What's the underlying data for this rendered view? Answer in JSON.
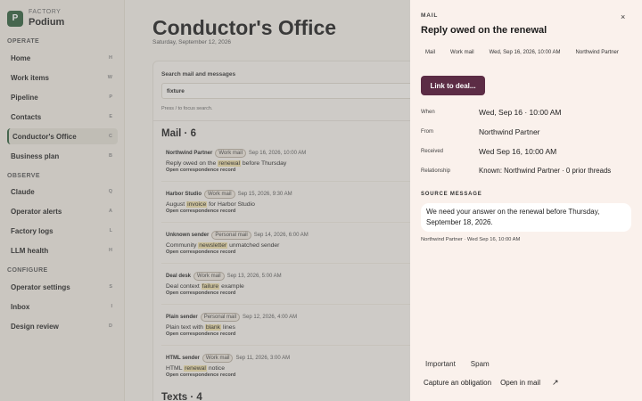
{
  "brand": {
    "kicker": "FACTORY",
    "name": "Podium",
    "logo": "P"
  },
  "sidebar": {
    "sections": [
      {
        "label": "OPERATE"
      },
      {
        "label": "OBSERVE"
      },
      {
        "label": "CONFIGURE"
      }
    ],
    "items": [
      {
        "label": "Home",
        "key": "H"
      },
      {
        "label": "Work items",
        "key": "W"
      },
      {
        "label": "Pipeline",
        "key": "P"
      },
      {
        "label": "Contacts",
        "key": "E"
      },
      {
        "label": "Conductor's Office",
        "key": "C"
      },
      {
        "label": "Business plan",
        "key": "B"
      },
      {
        "label": "Claude",
        "key": "Q"
      },
      {
        "label": "Operator alerts",
        "key": "A"
      },
      {
        "label": "Factory logs",
        "key": "L"
      },
      {
        "label": "LLM health",
        "key": "H"
      },
      {
        "label": "Operator settings",
        "key": "S"
      },
      {
        "label": "Inbox",
        "key": "I"
      },
      {
        "label": "Design review",
        "key": "D"
      }
    ]
  },
  "main": {
    "title": "Conductor's Office",
    "date": "Saturday, September 12, 2026",
    "search": {
      "label": "Search mail and messages",
      "value": "fixture",
      "hint": "Press / to focus search."
    },
    "mail_heading": "Mail · 6",
    "texts_heading": "Texts · 4",
    "mails": [
      {
        "sender": "Northwind Partner",
        "badge": "Work mail",
        "date": "Sep 16, 2026, 10:00 AM",
        "pre": "Reply owed on the ",
        "hl": "renewal",
        "post": " before Thursday",
        "link": "Open correspondence record"
      },
      {
        "sender": "Harbor Studio",
        "badge": "Work mail",
        "date": "Sep 15, 2026, 9:30 AM",
        "pre": "August ",
        "hl": "invoice",
        "post": " for Harbor Studio",
        "link": "Open correspondence record"
      },
      {
        "sender": "Unknown sender",
        "badge": "Personal mail",
        "date": "Sep 14, 2026, 6:00 AM",
        "pre": "Community ",
        "hl": "newsletter",
        "post": " unmatched sender",
        "link": "Open correspondence record"
      },
      {
        "sender": "Deal desk",
        "badge": "Work mail",
        "date": "Sep 13, 2026, 5:00 AM",
        "pre": "Deal context ",
        "hl": "failure",
        "post": " example",
        "link": "Open correspondence record"
      },
      {
        "sender": "Plain sender",
        "badge": "Personal mail",
        "date": "Sep 12, 2026, 4:00 AM",
        "pre": "Plain text with ",
        "hl": "blank",
        "post": " lines",
        "link": "Open correspondence record"
      },
      {
        "sender": "HTML sender",
        "badge": "Work mail",
        "date": "Sep 11, 2026, 3:00 AM",
        "pre": "HTML ",
        "hl": "renewal",
        "post": " notice",
        "link": "Open correspondence record"
      }
    ]
  },
  "drawer": {
    "kicker": "MAIL",
    "close": "×",
    "title": "Reply owed on the renewal",
    "tags": [
      "Mail",
      "Work mail",
      "Wed, Sep 16, 2026, 10:00 AM",
      "Northwind Partner"
    ],
    "link_button": "Link to deal...",
    "meta": [
      {
        "key": "When",
        "value": "Wed, Sep 16 · 10:00 AM"
      },
      {
        "key": "From",
        "value": "Northwind Partner"
      },
      {
        "key": "Received",
        "value": "Wed Sep 16, 10:00 AM"
      },
      {
        "key": "Relationship",
        "value": "Known: Northwind Partner · 0 prior threads"
      }
    ],
    "source_label": "SOURCE MESSAGE",
    "source_body": "We need your answer on the renewal before Thursday, September 18, 2026.",
    "source_meta": "Northwind Partner · Wed Sep 16, 10:00 AM",
    "actions_row1": [
      "Important",
      "Spam"
    ],
    "action_capture": "Capture an obligation",
    "action_open": "Open in mail",
    "open_icon": "↗"
  },
  "colors": {
    "accent": "#2f5d3a",
    "link_button": "#5c2c45",
    "highlight": "#f1e0a8"
  }
}
